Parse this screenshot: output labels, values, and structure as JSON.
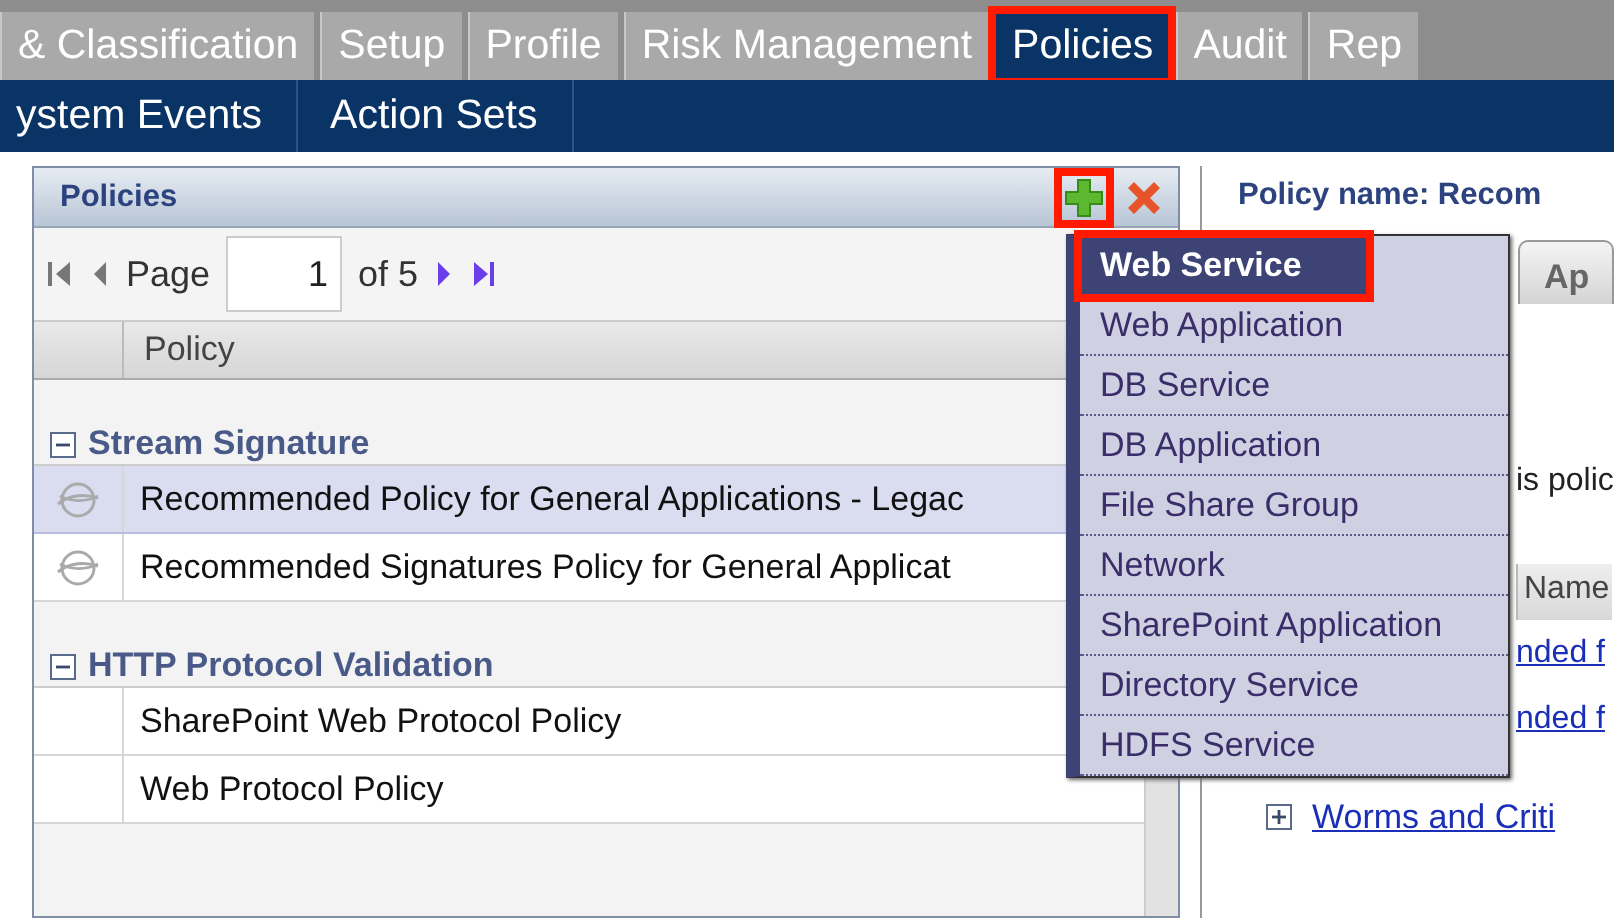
{
  "top_tabs": [
    {
      "label": "& Classification",
      "selected": false,
      "highlighted": false
    },
    {
      "label": "Setup",
      "selected": false,
      "highlighted": false
    },
    {
      "label": "Profile",
      "selected": false,
      "highlighted": false
    },
    {
      "label": "Risk Management",
      "selected": false,
      "highlighted": false
    },
    {
      "label": "Policies",
      "selected": true,
      "highlighted": true
    },
    {
      "label": "Audit",
      "selected": false,
      "highlighted": false
    },
    {
      "label": "Rep",
      "selected": false,
      "highlighted": false
    }
  ],
  "sub_tabs": [
    {
      "label": "ystem Events"
    },
    {
      "label": "Action Sets"
    }
  ],
  "policies_panel": {
    "title": "Policies",
    "add_button_highlighted": true,
    "pager": {
      "label": "Page",
      "value": "1",
      "total": "of 5"
    },
    "columns": [
      "Policy"
    ],
    "groups": [
      {
        "name": "Stream Signature",
        "expanded": true,
        "rows": [
          {
            "name": "Recommended Policy for General Applications - Legac",
            "kind": "signature",
            "selected": true
          },
          {
            "name": "Recommended Signatures Policy for General Applicat",
            "kind": "signature",
            "selected": false
          }
        ]
      },
      {
        "name": "HTTP Protocol Validation",
        "expanded": true,
        "rows": [
          {
            "name": "SharePoint Web Protocol Policy",
            "kind": "plain",
            "selected": false
          },
          {
            "name": "Web Protocol Policy",
            "kind": "plain",
            "selected": false
          }
        ]
      }
    ]
  },
  "add_menu": {
    "items": [
      {
        "label": "Web Service",
        "selected": true,
        "highlighted": true
      },
      {
        "label": "Web Application",
        "selected": false,
        "highlighted": false
      },
      {
        "label": "DB Service",
        "selected": false,
        "highlighted": false
      },
      {
        "label": "DB Application",
        "selected": false,
        "highlighted": false
      },
      {
        "label": "File Share Group",
        "selected": false,
        "highlighted": false
      },
      {
        "label": "Network",
        "selected": false,
        "highlighted": false
      },
      {
        "label": "SharePoint Application",
        "selected": false,
        "highlighted": false
      },
      {
        "label": "Directory Service",
        "selected": false,
        "highlighted": false
      },
      {
        "label": "HDFS Service",
        "selected": false,
        "highlighted": false
      }
    ]
  },
  "detail": {
    "title": "Policy name: Recom",
    "tab": "Ap",
    "text": "is polic",
    "column": "Name",
    "links": [
      "nded f",
      "nded f"
    ],
    "row": {
      "label": "Worms and Criti",
      "expanded": false
    }
  }
}
